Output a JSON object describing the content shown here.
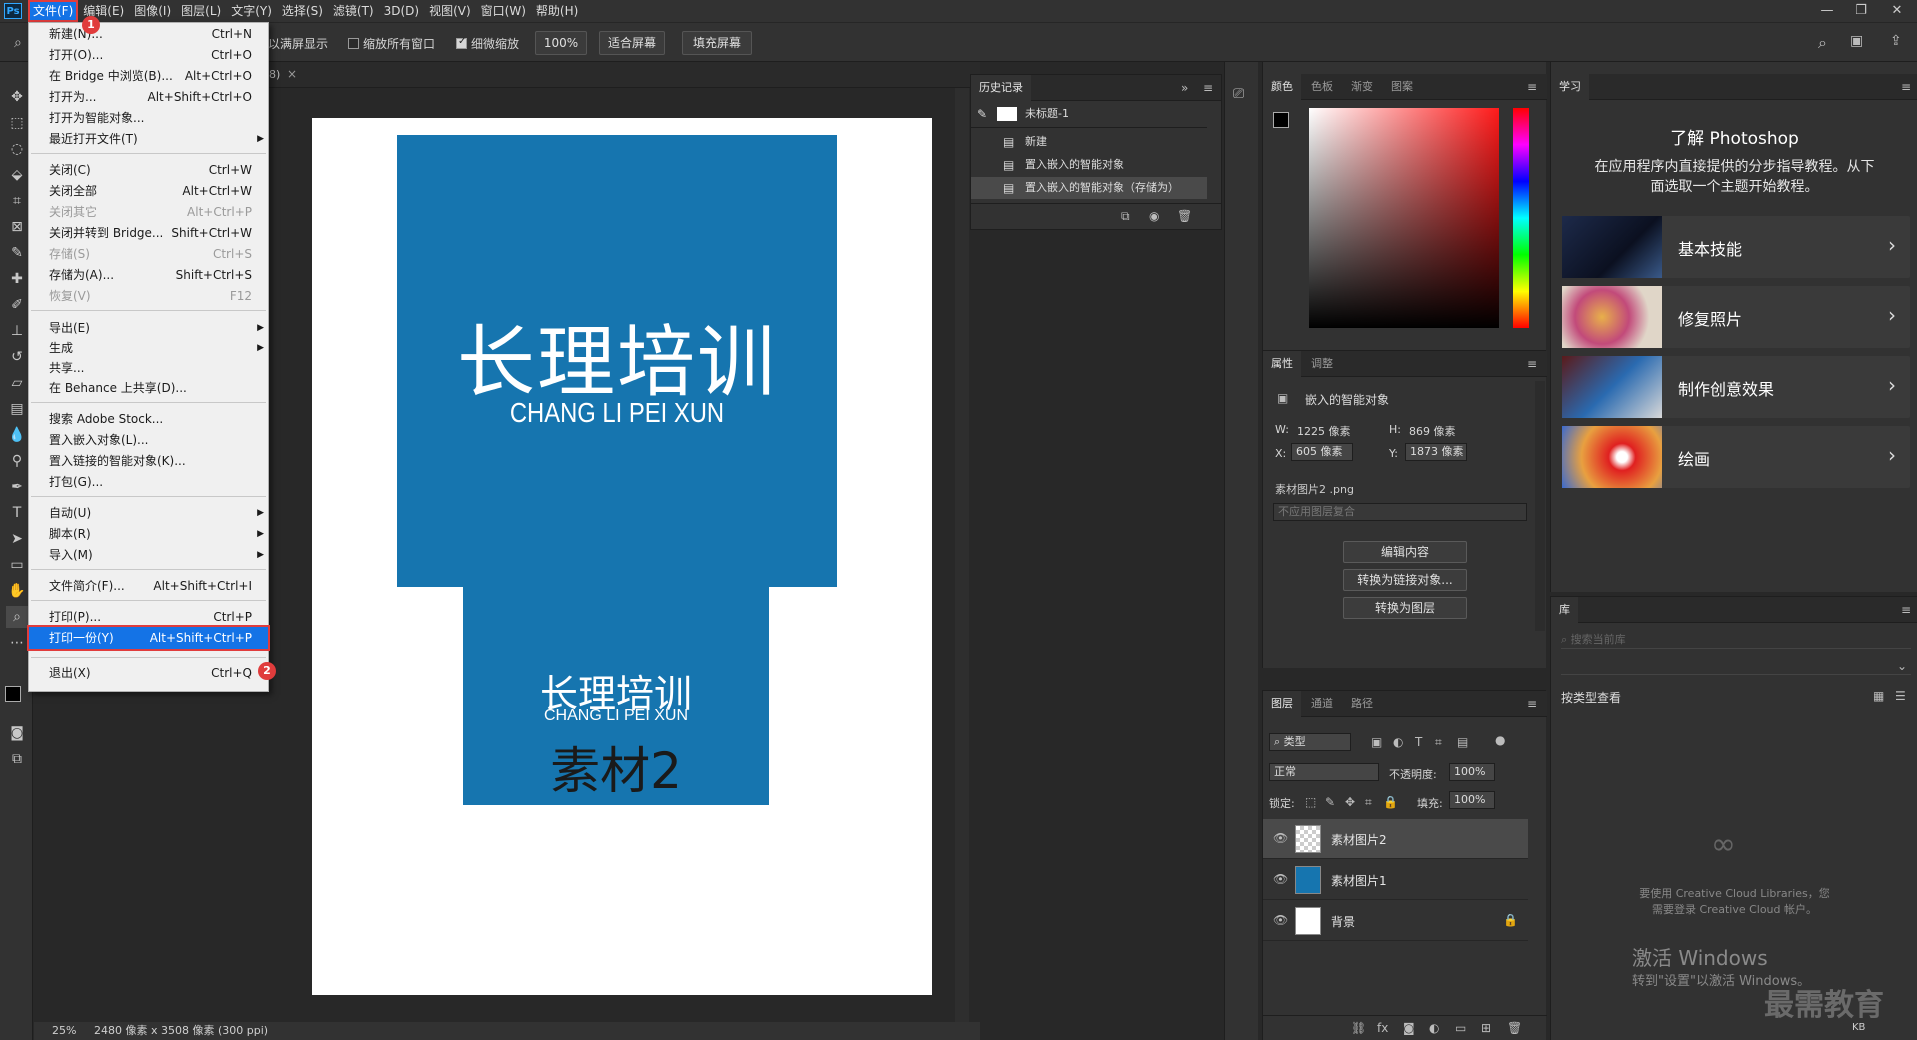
{
  "menubar": {
    "items": [
      "文件(F)",
      "编辑(E)",
      "图像(I)",
      "图层(L)",
      "文字(Y)",
      "选择(S)",
      "滤镜(T)",
      "3D(D)",
      "视图(V)",
      "窗口(W)",
      "帮助(H)"
    ],
    "logo": "Ps"
  },
  "options": {
    "full_screen_label": "以满屏显示",
    "scroll_all_label": "缩放所有窗口",
    "scrubby_zoom_label": "细微缩放",
    "zoom_value": "100%",
    "fit_screen": "适合屏幕",
    "fill_screen": "填充屏幕"
  },
  "doc_tab": {
    "suffix": "8)",
    "close": "×"
  },
  "file_menu": {
    "items": [
      {
        "label": "新建(N)...",
        "shortcut": "Ctrl+N"
      },
      {
        "label": "打开(O)...",
        "shortcut": "Ctrl+O"
      },
      {
        "label": "在 Bridge 中浏览(B)...",
        "shortcut": "Alt+Ctrl+O"
      },
      {
        "label": "打开为...",
        "shortcut": "Alt+Shift+Ctrl+O"
      },
      {
        "label": "打开为智能对象...",
        "shortcut": ""
      },
      {
        "label": "最近打开文件(T)",
        "shortcut": ""
      },
      {
        "label": "关闭(C)",
        "shortcut": "Ctrl+W"
      },
      {
        "label": "关闭全部",
        "shortcut": "Alt+Ctrl+W"
      },
      {
        "label": "关闭其它",
        "shortcut": "Alt+Ctrl+P"
      },
      {
        "label": "关闭并转到 Bridge...",
        "shortcut": "Shift+Ctrl+W"
      },
      {
        "label": "存储(S)",
        "shortcut": "Ctrl+S"
      },
      {
        "label": "存储为(A)...",
        "shortcut": "Shift+Ctrl+S"
      },
      {
        "label": "恢复(V)",
        "shortcut": "F12"
      },
      {
        "label": "导出(E)",
        "shortcut": ""
      },
      {
        "label": "生成",
        "shortcut": ""
      },
      {
        "label": "共享...",
        "shortcut": ""
      },
      {
        "label": "在 Behance 上共享(D)...",
        "shortcut": ""
      },
      {
        "label": "搜索 Adobe Stock...",
        "shortcut": ""
      },
      {
        "label": "置入嵌入对象(L)...",
        "shortcut": ""
      },
      {
        "label": "置入链接的智能对象(K)...",
        "shortcut": ""
      },
      {
        "label": "打包(G)...",
        "shortcut": ""
      },
      {
        "label": "自动(U)",
        "shortcut": ""
      },
      {
        "label": "脚本(R)",
        "shortcut": ""
      },
      {
        "label": "导入(M)",
        "shortcut": ""
      },
      {
        "label": "文件简介(F)...",
        "shortcut": "Alt+Shift+Ctrl+I"
      },
      {
        "label": "打印(P)...",
        "shortcut": "Ctrl+P"
      },
      {
        "label": "打印一份(Y)",
        "shortcut": "Alt+Shift+Ctrl+P"
      },
      {
        "label": "退出(X)",
        "shortcut": "Ctrl+Q"
      }
    ],
    "badge1": "1",
    "badge2": "2"
  },
  "canvas": {
    "big_title": "长理培训",
    "big_sub": "CHANG LI PEI XUN",
    "small_title": "长理培训",
    "small_sub": "CHANG LI PEI XUN",
    "small_label": "素材2",
    "block_color": "#1675af"
  },
  "status": {
    "zoom": "25%",
    "doc_size": "2480 像素 x 3508 像素 (300 ppi)"
  },
  "history": {
    "tab": "历史记录",
    "snapshot": "未标题-1",
    "rows": [
      "新建",
      "置入嵌入的智能对象",
      "置入嵌入的智能对象（存储为）"
    ]
  },
  "color_panel": {
    "tabs": [
      "颜色",
      "色板",
      "渐变",
      "图案"
    ]
  },
  "properties": {
    "tabs": [
      "属性",
      "调整"
    ],
    "type_label": "嵌入的智能对象",
    "w_label": "W:",
    "w_value": "1225 像素",
    "h_label": "H:",
    "h_value": "869 像素",
    "x_label": "X:",
    "x_value": "605 像素",
    "y_label": "Y:",
    "y_value": "1873 像素",
    "file_name": "素材图片2 .png",
    "comp_placeholder": "不应用图层复合",
    "btn_edit": "编辑内容",
    "btn_link": "转换为链接对象...",
    "btn_layer": "转换为图层"
  },
  "layers": {
    "tabs": [
      "图层",
      "通道",
      "路径"
    ],
    "filter_label": "类型",
    "blend_mode": "正常",
    "opacity_label": "不透明度:",
    "opacity_value": "100%",
    "lock_label": "锁定:",
    "fill_label": "填充:",
    "fill_value": "100%",
    "rows": [
      "素材图片2",
      "素材图片1",
      "背景"
    ]
  },
  "learn": {
    "tab": "学习",
    "heading": "了解 Photoshop",
    "desc_line1": "在应用程序内直接提供的分步指导教程。从下",
    "desc_line2": "面选取一个主题开始教程。",
    "cards": [
      "基本技能",
      "修复照片",
      "制作创意效果",
      "绘画"
    ]
  },
  "library": {
    "tab": "库",
    "search_placeholder": "搜索当前库",
    "view_label": "按类型查看",
    "cc_line1": "要使用 Creative Cloud Libraries，您",
    "cc_line2": "需要登录 Creative Cloud 帐户。"
  },
  "watermark": {
    "activate_title": "激活 Windows",
    "activate_sub": "转到\"设置\"以激活 Windows。",
    "brand": "最需教育",
    "net_speed": "KB"
  }
}
